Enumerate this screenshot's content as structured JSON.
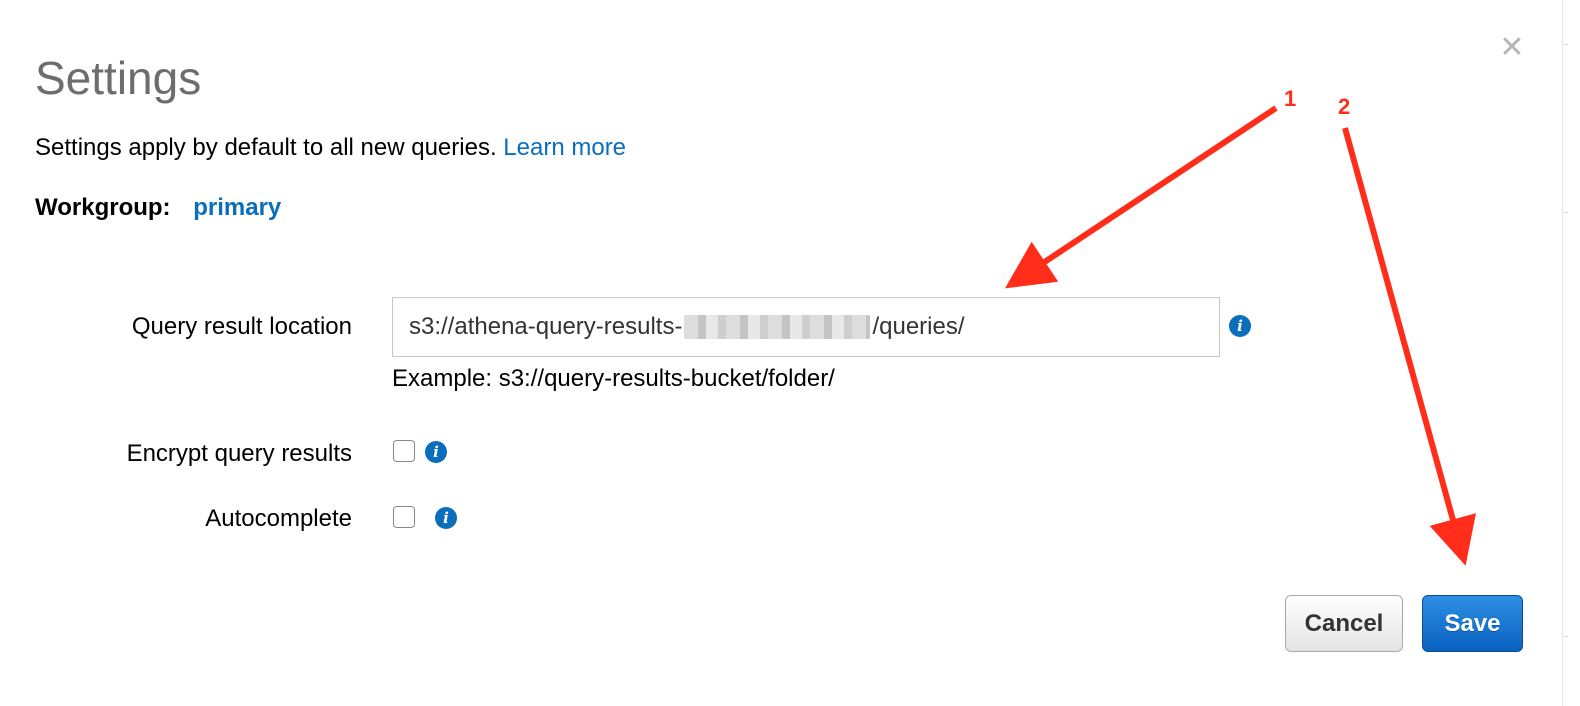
{
  "dialog": {
    "title": "Settings",
    "subtitle": "Settings apply by default to all new queries.",
    "learn_more": "Learn more",
    "workgroup_label": "Workgroup:",
    "workgroup_value": "primary"
  },
  "form": {
    "query_result_location": {
      "label": "Query result location",
      "value_prefix": "s3://athena-query-results-",
      "value_suffix": "/queries/",
      "example": "Example: s3://query-results-bucket/folder/"
    },
    "encrypt": {
      "label": "Encrypt query results",
      "checked": false
    },
    "autocomplete": {
      "label": "Autocomplete",
      "checked": false
    }
  },
  "buttons": {
    "cancel": "Cancel",
    "save": "Save"
  },
  "annotations": {
    "one": "1",
    "two": "2"
  },
  "icons": {
    "close": "close-icon",
    "info": "info-icon"
  },
  "colors": {
    "link": "#0a6ebd",
    "primary_button": "#0a62c0",
    "annotation": "#ff2d1a"
  }
}
